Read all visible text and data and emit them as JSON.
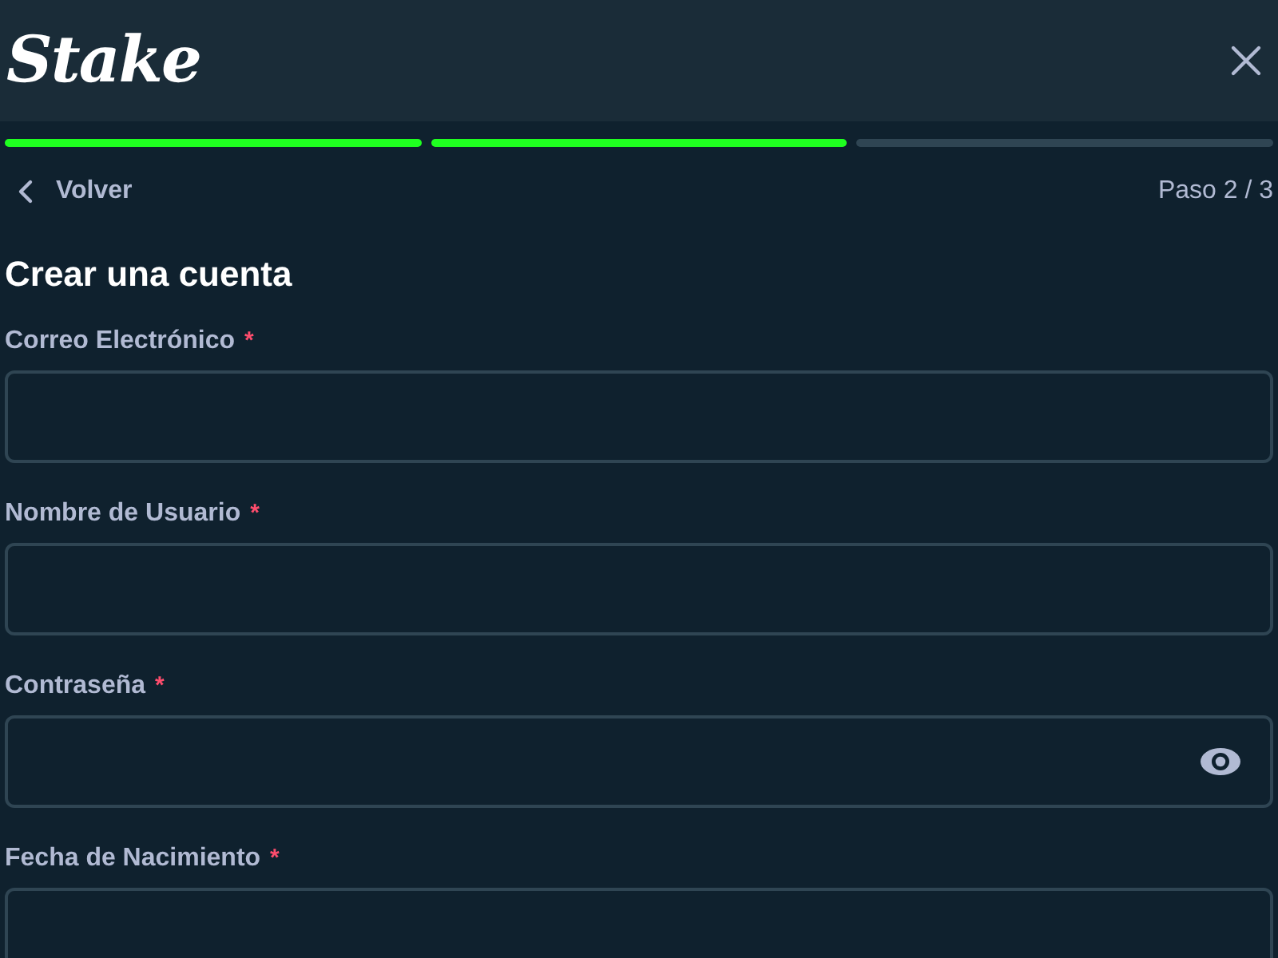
{
  "header": {
    "logo": "Stake"
  },
  "progress": [
    {
      "complete": true
    },
    {
      "complete": true
    },
    {
      "complete": false
    }
  ],
  "nav": {
    "back": "Volver",
    "step": "Paso 2 / 3"
  },
  "title": "Crear una cuenta",
  "fields": [
    {
      "label": "Correo Electrónico",
      "required_mark": "*",
      "kind": "text"
    },
    {
      "label": "Nombre de Usuario",
      "required_mark": "*",
      "kind": "text"
    },
    {
      "label": "Contraseña",
      "required_mark": "*",
      "kind": "password"
    },
    {
      "label": "Fecha de Nacimiento",
      "required_mark": "*",
      "kind": "text"
    }
  ]
}
